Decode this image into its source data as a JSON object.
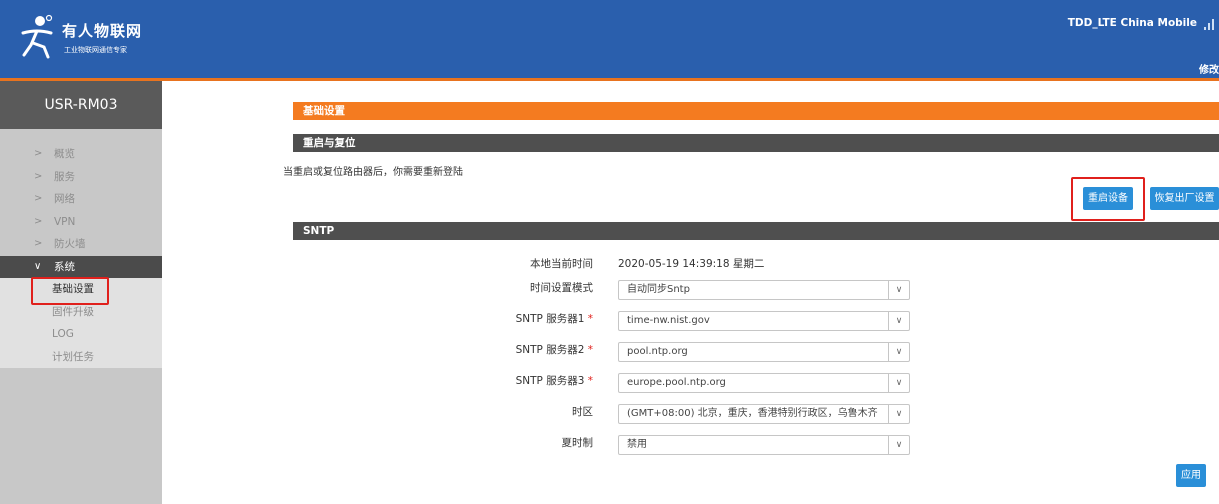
{
  "header": {
    "brand_name": "有人物联网",
    "brand_sub": "工业物联网通信专家",
    "carrier": "TDD_LTE China Mobile",
    "logout_partial": "修改"
  },
  "sidebar": {
    "device": "USR-RM03",
    "items": [
      {
        "label": "概览",
        "expanded": false
      },
      {
        "label": "服务",
        "expanded": false
      },
      {
        "label": "网络",
        "expanded": false
      },
      {
        "label": "VPN",
        "expanded": false
      },
      {
        "label": "防火墙",
        "expanded": false
      },
      {
        "label": "系统",
        "expanded": true
      }
    ],
    "subitems": [
      "基础设置",
      "固件升级",
      "LOG",
      "计划任务"
    ],
    "selected_subitem": "基础设置"
  },
  "main": {
    "page_title": "基础设置",
    "reboot_section": {
      "title": "重启与复位",
      "note": "当重启或复位路由器后，你需要重新登陆",
      "reboot_button": "重启设备",
      "reset_button": "恢复出厂设置"
    },
    "sntp_section": {
      "title": "SNTP",
      "local_time_label": "本地当前时间",
      "local_time_value": "2020-05-19 14:39:18 星期二",
      "mode_label": "时间设置模式",
      "mode_value": "自动同步Sntp",
      "server1_label": "SNTP 服务器1",
      "server1_value": "time-nw.nist.gov",
      "server2_label": "SNTP 服务器2",
      "server2_value": "pool.ntp.org",
      "server3_label": "SNTP 服务器3",
      "server3_value": "europe.pool.ntp.org",
      "required_mark": "*",
      "timezone_label": "时区",
      "timezone_value": "(GMT+08:00) 北京，重庆，香港特别行政区，乌鲁木齐",
      "dst_label": "夏时制",
      "dst_value": "禁用",
      "apply_button": "应用"
    }
  },
  "colors": {
    "header_bg": "#2a5fad",
    "accent_orange": "#f47b20",
    "button_blue": "#2a8fd8",
    "highlight_red": "#e0201c"
  }
}
